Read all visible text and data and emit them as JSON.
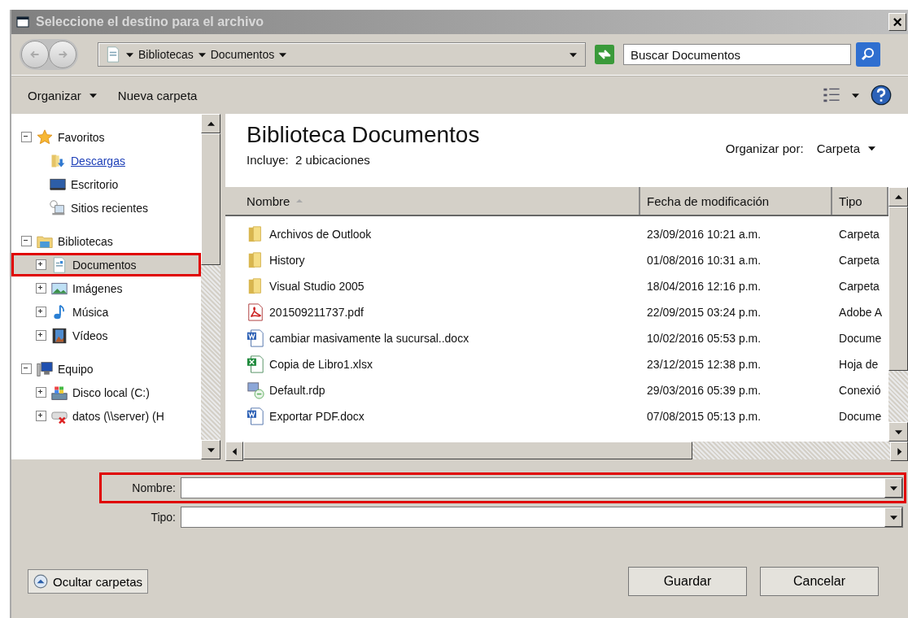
{
  "window": {
    "title": "Seleccione el destino para el archivo",
    "close": "×"
  },
  "address": {
    "crumbs": [
      "Bibliotecas",
      "Documentos"
    ]
  },
  "search": {
    "placeholder": "Buscar Documentos"
  },
  "toolbar": [
    {
      "label": "Organizar",
      "dropdown": true
    },
    {
      "label": "Nueva carpeta",
      "dropdown": false
    }
  ],
  "tree": [
    {
      "label": "Favoritos",
      "kind": "star",
      "expanded": true,
      "selected": false,
      "highlighted": false,
      "hovered": false,
      "children": [
        {
          "label": "Descargas",
          "kind": "downloads",
          "selected": false,
          "highlighted": false,
          "hovered": true
        },
        {
          "label": "Escritorio",
          "kind": "desktop",
          "selected": false,
          "highlighted": false,
          "hovered": false
        },
        {
          "label": "Sitios recientes",
          "kind": "recent",
          "selected": false,
          "highlighted": false,
          "hovered": false
        }
      ]
    },
    {
      "label": "Bibliotecas",
      "kind": "library",
      "expanded": true,
      "selected": false,
      "highlighted": false,
      "hovered": false,
      "children": [
        {
          "label": "Documentos",
          "kind": "document",
          "expanded": false,
          "selected": true,
          "highlighted": true,
          "hovered": false
        },
        {
          "label": "Imágenes",
          "kind": "images",
          "expanded": false,
          "selected": false,
          "highlighted": false,
          "hovered": false
        },
        {
          "label": "Música",
          "kind": "music",
          "expanded": false,
          "selected": false,
          "highlighted": false,
          "hovered": false
        },
        {
          "label": "Vídeos",
          "kind": "videos",
          "expanded": false,
          "selected": false,
          "highlighted": false,
          "hovered": false
        }
      ]
    },
    {
      "label": "Equipo",
      "kind": "computer",
      "expanded": true,
      "selected": false,
      "highlighted": false,
      "hovered": false,
      "children": [
        {
          "label": "Disco local (C:)",
          "kind": "disk",
          "expanded": false,
          "selected": false,
          "highlighted": false,
          "hovered": false
        },
        {
          "label": "datos (\\\\server) (H",
          "kind": "netdrive",
          "expanded": false,
          "selected": false,
          "highlighted": false,
          "hovered": false
        }
      ]
    }
  ],
  "library": {
    "title": "Biblioteca Documentos",
    "subtitle": "Incluye:  2 ubicaciones",
    "arrange_label": "Organizar por:",
    "arrange_value": "Carpeta"
  },
  "columns": [
    {
      "label": "Nombre",
      "sorted": true
    },
    {
      "label": "Fecha de modificación",
      "sorted": false
    },
    {
      "label": "Tipo",
      "sorted": false
    }
  ],
  "rows": [
    {
      "kind": "folder",
      "name": "Archivos de Outlook",
      "date": "23/09/2016 10:21 a.m.",
      "type": "Carpeta"
    },
    {
      "kind": "folder",
      "name": "History",
      "date": "01/08/2016 10:31 a.m.",
      "type": "Carpeta"
    },
    {
      "kind": "folder",
      "name": "Visual Studio 2005",
      "date": "18/04/2016 12:16 p.m.",
      "type": "Carpeta"
    },
    {
      "kind": "pdf",
      "name": "201509211737.pdf",
      "date": "22/09/2015 03:24 p.m.",
      "type": "Adobe A"
    },
    {
      "kind": "word",
      "name": "cambiar masivamente la sucursal..docx",
      "date": "10/02/2016 05:53 p.m.",
      "type": "Docume"
    },
    {
      "kind": "excel",
      "name": "Copia de Libro1.xlsx",
      "date": "23/12/2015 12:38 p.m.",
      "type": "Hoja de"
    },
    {
      "kind": "rdp",
      "name": "Default.rdp",
      "date": "29/03/2016 05:39 p.m.",
      "type": "Conexió"
    },
    {
      "kind": "word",
      "name": "Exportar PDF.docx",
      "date": "07/08/2015 05:13 p.m.",
      "type": "Docume"
    }
  ],
  "fields": [
    {
      "label": "Nombre:",
      "highlighted": true
    },
    {
      "label": "Tipo:",
      "highlighted": false
    }
  ],
  "hide_folders": "Ocultar carpetas",
  "actions": [
    "Guardar",
    "Cancelar"
  ]
}
